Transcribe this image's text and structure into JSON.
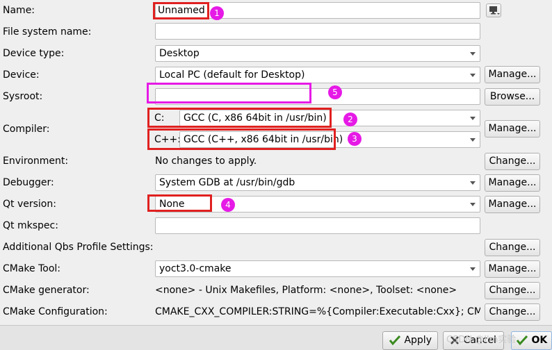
{
  "fields": {
    "name": {
      "label": "Name:",
      "value": "Unnamed"
    },
    "file_system_name": {
      "label": "File system name:",
      "value": ""
    },
    "device_type": {
      "label": "Device type:",
      "value": "Desktop"
    },
    "device": {
      "label": "Device:",
      "value": "Local PC (default for Desktop)",
      "button": "Manage..."
    },
    "sysroot": {
      "label": "Sysroot:",
      "value": "",
      "button": "Browse..."
    },
    "compiler": {
      "label": "Compiler:",
      "c_prefix": "C:",
      "c_value": "GCC (C, x86 64bit in /usr/bin)",
      "cpp_prefix": "C++:",
      "cpp_value": "GCC (C++, x86 64bit in /usr/bin)",
      "button": "Manage..."
    },
    "environment": {
      "label": "Environment:",
      "value": "No changes to apply.",
      "button": "Change..."
    },
    "debugger": {
      "label": "Debugger:",
      "value": "System GDB at /usr/bin/gdb",
      "button": "Manage..."
    },
    "qt_version": {
      "label": "Qt version:",
      "value": "None",
      "button": "Manage..."
    },
    "qt_mkspec": {
      "label": "Qt mkspec:",
      "value": ""
    },
    "qbs": {
      "label": "Additional Qbs Profile Settings:",
      "button": "Change..."
    },
    "cmake_tool": {
      "label": "CMake Tool:",
      "value": "yoct3.0-cmake",
      "button": "Manage..."
    },
    "cmake_generator": {
      "label": "CMake generator:",
      "value": "<none> - Unix Makefiles, Platform: <none>, Toolset: <none>",
      "button": "Change..."
    },
    "cmake_configuration": {
      "label": "CMake Configuration:",
      "value": "CMAKE_CXX_COMPILER:STRING=%{Compiler:Executable:Cxx}; CM...",
      "button": "Change..."
    }
  },
  "annotations": [
    "1",
    "2",
    "3",
    "4",
    "5"
  ],
  "footer": {
    "apply": "Apply",
    "cancel": "Cancel",
    "ok": "OK",
    "watermark": "CSDN @I'm实验"
  },
  "colors": {
    "annotation_red": "#e02020",
    "annotation_magenta": "#e61ae6"
  }
}
